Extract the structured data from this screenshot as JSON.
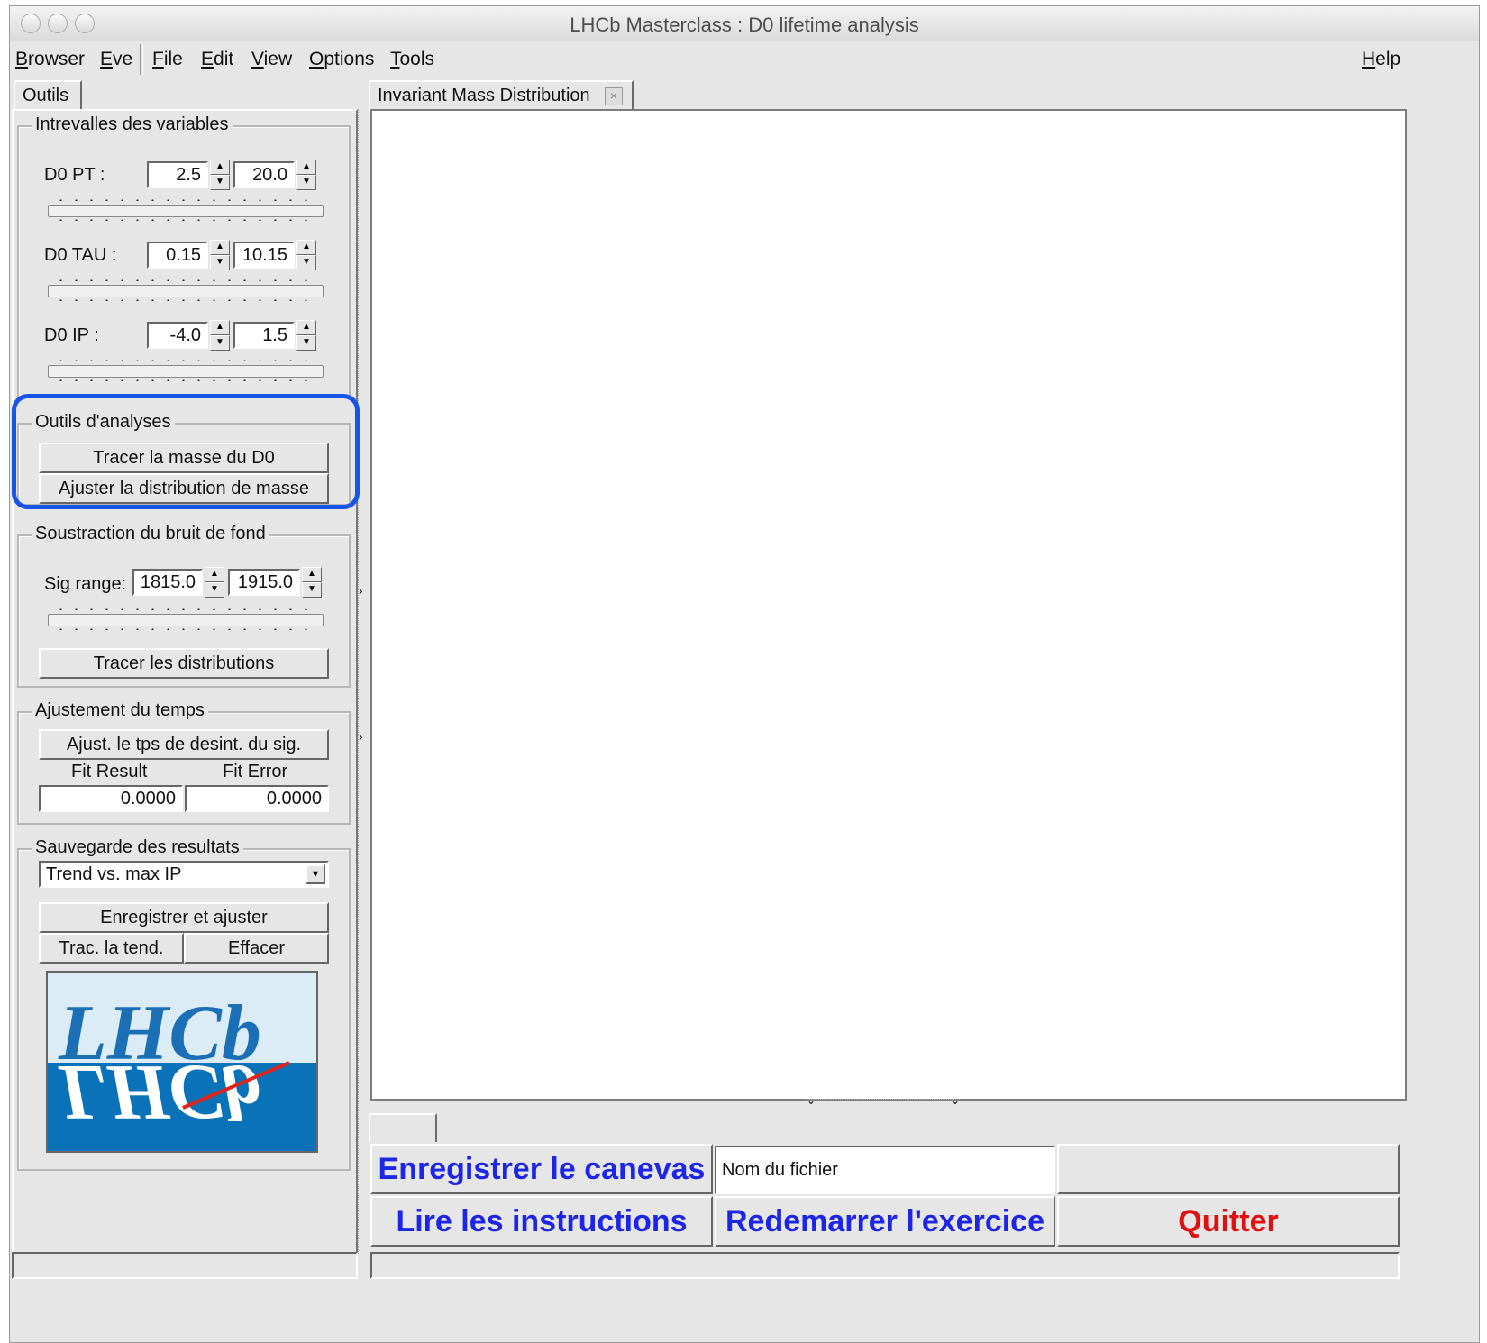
{
  "window": {
    "title": "LHCb Masterclass : D0 lifetime analysis"
  },
  "menubar": {
    "items": [
      "Browser",
      "Eve",
      "File",
      "Edit",
      "View",
      "Options",
      "Tools"
    ],
    "help": "Help"
  },
  "left_tab": {
    "label": "Outils"
  },
  "variables": {
    "title": "Intrevalles des variables",
    "rows": [
      {
        "label": "D0 PT :",
        "min": "2.5",
        "max": "20.0"
      },
      {
        "label": "D0 TAU :",
        "min": "0.15",
        "max": "10.15"
      },
      {
        "label": "D0 IP :",
        "min": "-4.0",
        "max": "1.5"
      }
    ]
  },
  "analysis_tools": {
    "title": "Outils d'analyses",
    "plot_mass": "Tracer la masse du D0",
    "fit_mass": "Ajuster la distribution de masse"
  },
  "background": {
    "title": "Soustraction du bruit de fond",
    "sig_label": "Sig range:",
    "sig_min": "1815.0",
    "sig_max": "1915.0",
    "plot_button": "Tracer les distributions"
  },
  "time_fit": {
    "title": "Ajustement du temps",
    "fit_button": "Ajust. le tps de desint. du sig.",
    "fit_result_label": "Fit Result",
    "fit_error_label": "Fit Error",
    "fit_result": "0.0000",
    "fit_error": "0.0000"
  },
  "save_results": {
    "title": "Sauvegarde des resultats",
    "select_value": "Trend vs. max IP",
    "save_fit": "Enregistrer et ajuster",
    "trend": "Trac. la tend.",
    "clear": "Effacer"
  },
  "logo": {
    "text": "LHCb",
    "colors": {
      "top": "#dcecf7",
      "bottom": "#0a72b8",
      "text": "#1a6fb5",
      "accent": "#e2231a"
    }
  },
  "canvas_tab": {
    "label": "Invariant Mass Distribution"
  },
  "bottom": {
    "save_canvas": "Enregistrer le canevas",
    "filename_placeholder": "Nom du fichier",
    "read_instructions": "Lire les instructions",
    "restart": "Redemarrer l'exercice",
    "quit": "Quitter",
    "quit_color": "#e01010",
    "btn_color": "#1d25e6"
  }
}
